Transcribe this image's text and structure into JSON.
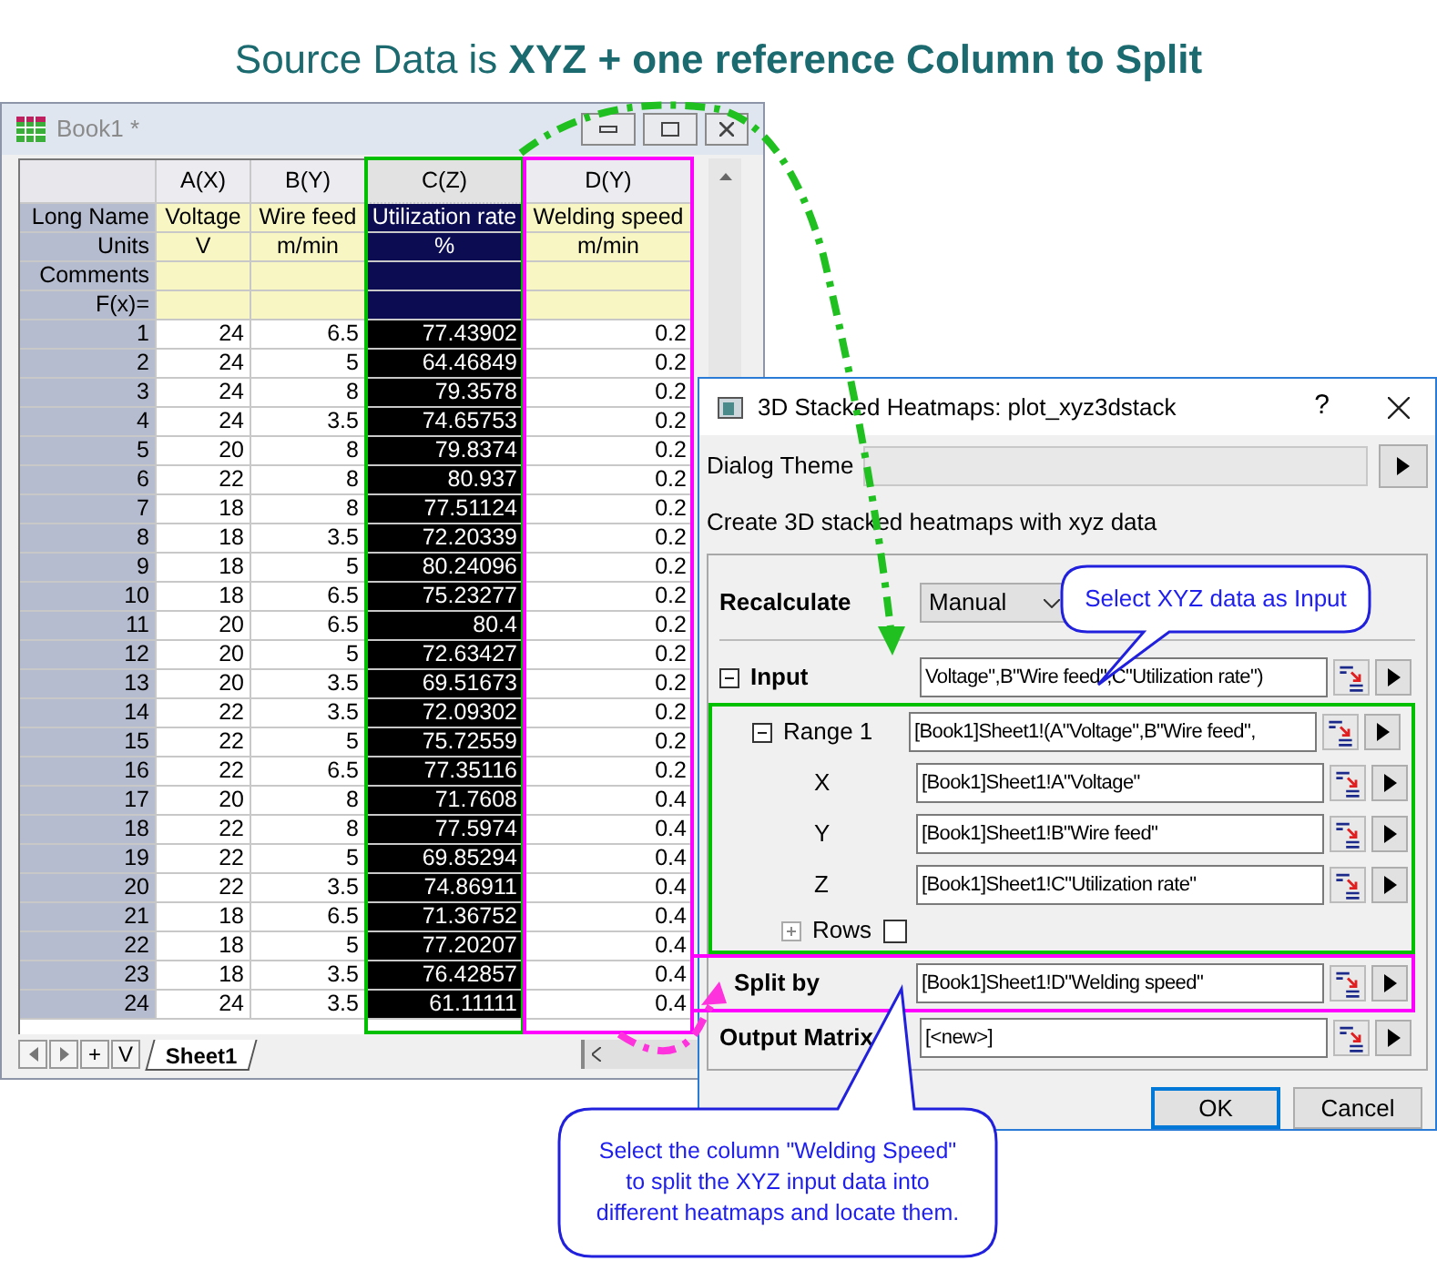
{
  "heading": "Source Data is **XYZ + one reference Column to Split**",
  "worksheet": {
    "title": "Book1 *",
    "row_labels": [
      "Long Name",
      "Units",
      "Comments",
      "F(x)="
    ],
    "columns": [
      {
        "label": "A(X)",
        "long_name": "Voltage",
        "units": "V",
        "selected": false
      },
      {
        "label": "B(Y)",
        "long_name": "Wire feed",
        "units": "m/min",
        "selected": false
      },
      {
        "label": "C(Z)",
        "long_name": "Utilization rate",
        "units": "%",
        "selected": true,
        "color": "#00c000"
      },
      {
        "label": "D(Y)",
        "long_name": "Welding speed",
        "units": "m/min",
        "selected": false,
        "color": "#ff00ff"
      }
    ],
    "rows": [
      {
        "index": "1",
        "cells": [
          "24",
          "6.5",
          "77.43902",
          "0.2"
        ]
      },
      {
        "index": "2",
        "cells": [
          "24",
          "5",
          "64.46849",
          "0.2"
        ]
      },
      {
        "index": "3",
        "cells": [
          "24",
          "8",
          "79.3578",
          "0.2"
        ]
      },
      {
        "index": "4",
        "cells": [
          "24",
          "3.5",
          "74.65753",
          "0.2"
        ]
      },
      {
        "index": "5",
        "cells": [
          "20",
          "8",
          "79.8374",
          "0.2"
        ]
      },
      {
        "index": "6",
        "cells": [
          "22",
          "8",
          "80.937",
          "0.2"
        ]
      },
      {
        "index": "7",
        "cells": [
          "18",
          "8",
          "77.51124",
          "0.2"
        ]
      },
      {
        "index": "8",
        "cells": [
          "18",
          "3.5",
          "72.20339",
          "0.2"
        ]
      },
      {
        "index": "9",
        "cells": [
          "18",
          "5",
          "80.24096",
          "0.2"
        ]
      },
      {
        "index": "10",
        "cells": [
          "18",
          "6.5",
          "75.23277",
          "0.2"
        ]
      },
      {
        "index": "11",
        "cells": [
          "20",
          "6.5",
          "80.4",
          "0.2"
        ]
      },
      {
        "index": "12",
        "cells": [
          "20",
          "5",
          "72.63427",
          "0.2"
        ]
      },
      {
        "index": "13",
        "cells": [
          "20",
          "3.5",
          "69.51673",
          "0.2"
        ]
      },
      {
        "index": "14",
        "cells": [
          "22",
          "3.5",
          "72.09302",
          "0.2"
        ]
      },
      {
        "index": "15",
        "cells": [
          "22",
          "5",
          "75.72559",
          "0.2"
        ]
      },
      {
        "index": "16",
        "cells": [
          "22",
          "6.5",
          "77.35116",
          "0.2"
        ]
      },
      {
        "index": "17",
        "cells": [
          "20",
          "8",
          "71.7608",
          "0.4"
        ]
      },
      {
        "index": "18",
        "cells": [
          "22",
          "8",
          "77.5974",
          "0.4"
        ]
      },
      {
        "index": "19",
        "cells": [
          "22",
          "5",
          "69.85294",
          "0.4"
        ]
      },
      {
        "index": "20",
        "cells": [
          "22",
          "3.5",
          "74.86911",
          "0.4"
        ]
      },
      {
        "index": "21",
        "cells": [
          "18",
          "6.5",
          "71.36752",
          "0.4"
        ]
      },
      {
        "index": "22",
        "cells": [
          "18",
          "5",
          "77.20207",
          "0.4"
        ]
      },
      {
        "index": "23",
        "cells": [
          "18",
          "3.5",
          "76.42857",
          "0.4"
        ]
      },
      {
        "index": "24",
        "cells": [
          "24",
          "3.5",
          "61.11111",
          "0.4"
        ]
      }
    ],
    "nav_buttons": [
      "+",
      "V"
    ],
    "sheet_tab": "Sheet1"
  },
  "dialog": {
    "title": "3D Stacked Heatmaps: plot_xyz3dstack",
    "help": "?",
    "theme_label": "Dialog Theme",
    "description": "Create 3D stacked heatmaps with xyz data",
    "recalculate": {
      "label": "Recalculate",
      "value": "Manual"
    },
    "params": [
      {
        "kind": "group",
        "label": "Input",
        "expanded": true,
        "value": "Voltage\",B\"Wire feed\",C\"Utilization rate\")",
        "children": [
          {
            "kind": "group",
            "label": "Range 1",
            "expanded": true,
            "color": "#00c000",
            "value": "[Book1]Sheet1!(A\"Voltage\",B\"Wire feed\",",
            "children": [
              {
                "kind": "field",
                "label": "X",
                "value": "[Book1]Sheet1!A\"Voltage\""
              },
              {
                "kind": "field",
                "label": "Y",
                "value": "[Book1]Sheet1!B\"Wire feed\""
              },
              {
                "kind": "field",
                "label": "Z",
                "value": "[Book1]Sheet1!C\"Utilization rate\""
              },
              {
                "kind": "checkbox",
                "label": "Rows",
                "expanded": false,
                "checked": false
              }
            ]
          }
        ]
      },
      {
        "kind": "field",
        "label": "Split by",
        "value": "[Book1]Sheet1!D\"Welding speed\"",
        "color": "#ff00ff"
      },
      {
        "kind": "field",
        "label": "Output Matrix",
        "value": "[<new>]"
      }
    ],
    "buttons": [
      {
        "label": "OK",
        "selected": true
      },
      {
        "label": "Cancel",
        "selected": false
      }
    ]
  },
  "callouts": [
    {
      "text": "Select XYZ data as Input"
    },
    {
      "text": "Select the column \"Welding Speed\" to split the XYZ input data into different heatmaps and locate them."
    }
  ]
}
